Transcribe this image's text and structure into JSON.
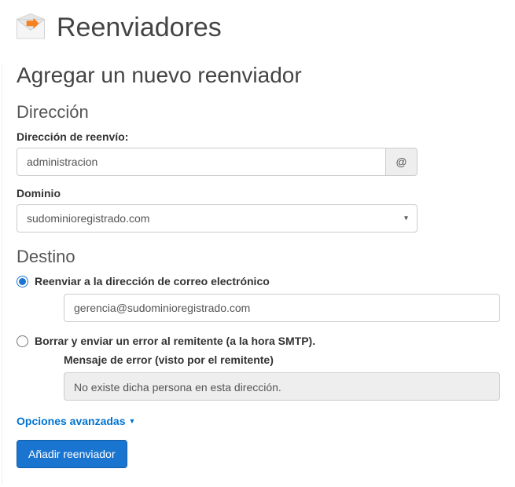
{
  "header": {
    "title": "Reenviadores"
  },
  "section": {
    "title": "Agregar un nuevo reenviador"
  },
  "address": {
    "heading": "Dirección",
    "forward_label": "Dirección de reenvío:",
    "forward_value": "administracion",
    "at_symbol": "@",
    "domain_label": "Dominio",
    "domain_value": "sudominioregistrado.com"
  },
  "destination": {
    "heading": "Destino",
    "opt_forward_label": "Reenviar a la dirección de correo electrónico",
    "forward_email_value": "gerencia@sudominioregistrado.com",
    "opt_discard_label": "Borrar y enviar un error al remitente (a la hora SMTP).",
    "error_msg_label": "Mensaje de error (visto por el remitente)",
    "error_msg_value": "No existe dicha persona en esta dirección."
  },
  "advanced_link": "Opciones avanzadas",
  "submit_label": "Añadir reenviador"
}
